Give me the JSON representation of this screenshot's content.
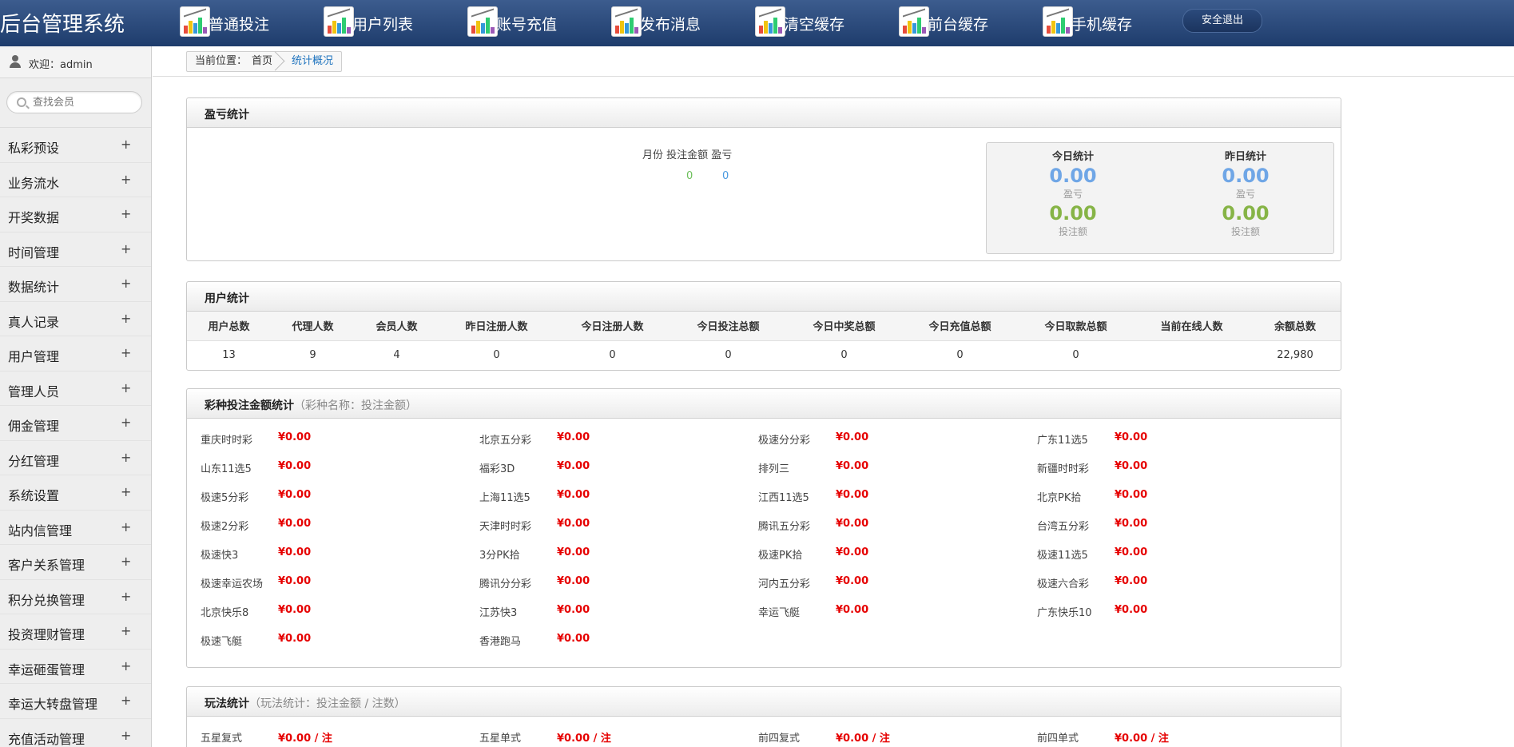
{
  "header": {
    "logo": "后台管理系统",
    "nav": [
      {
        "label": "普通投注",
        "icon": "chart-icon"
      },
      {
        "label": "用户列表",
        "icon": "chart-icon"
      },
      {
        "label": "账号充值",
        "icon": "chart-icon"
      },
      {
        "label": "发布消息",
        "icon": "chart-icon"
      },
      {
        "label": "清空缓存",
        "icon": "chart-icon"
      },
      {
        "label": "前台缓存",
        "icon": "chart-icon"
      },
      {
        "label": "手机缓存",
        "icon": "chart-icon"
      }
    ],
    "logout": "安全退出"
  },
  "sidebar": {
    "welcome": "欢迎：admin",
    "search_placeholder": "查找会员",
    "items": [
      {
        "label": "私彩预设",
        "plus": "+"
      },
      {
        "label": "业务流水",
        "plus": "+"
      },
      {
        "label": "开奖数据",
        "plus": "+"
      },
      {
        "label": "时间管理",
        "plus": "+"
      },
      {
        "label": "数据统计",
        "plus": "+"
      },
      {
        "label": "真人记录",
        "plus": "+"
      },
      {
        "label": "用户管理",
        "plus": "+"
      },
      {
        "label": "管理人员",
        "plus": "+"
      },
      {
        "label": "佣金管理",
        "plus": "+"
      },
      {
        "label": "分红管理",
        "plus": "+"
      },
      {
        "label": "系统设置",
        "plus": "+"
      },
      {
        "label": "站内信管理",
        "plus": "+"
      },
      {
        "label": "客户关系管理",
        "plus": "+"
      },
      {
        "label": "积分兑换管理",
        "plus": "+"
      },
      {
        "label": "投资理财管理",
        "plus": "+"
      },
      {
        "label": "幸运砸蛋管理",
        "plus": "+"
      },
      {
        "label": "幸运大转盘管理",
        "plus": "+"
      },
      {
        "label": "充值活动管理",
        "plus": "+"
      }
    ]
  },
  "breadcrumb": {
    "prefix": "当前位置：",
    "home": "首页",
    "current": "统计概况"
  },
  "profit_panel": {
    "title": "盈亏统计",
    "legend": "月份 投注金额 盈亏",
    "bet_value": "0",
    "profit_value": "0",
    "today": {
      "title": "今日统计",
      "profit": "0.00",
      "profit_label": "盈亏",
      "bet": "0.00",
      "bet_label": "投注额"
    },
    "yesterday": {
      "title": "昨日统计",
      "profit": "0.00",
      "profit_label": "盈亏",
      "bet": "0.00",
      "bet_label": "投注额"
    }
  },
  "user_panel": {
    "title": "用户统计",
    "headers": [
      "用户总数",
      "代理人数",
      "会员人数",
      "昨日注册人数",
      "今日注册人数",
      "今日投注总额",
      "今日中奖总额",
      "今日充值总额",
      "今日取款总额",
      "当前在线人数",
      "余额总数"
    ],
    "values": [
      "13",
      "9",
      "4",
      "0",
      "0",
      "0",
      "0",
      "0",
      "0",
      "",
      "22,980"
    ]
  },
  "lottery_panel": {
    "title": "彩种投注金额统计",
    "subtitle": "（彩种名称：投注金额）",
    "items": [
      {
        "name": "重庆时时彩",
        "value": "¥0.00"
      },
      {
        "name": "北京五分彩",
        "value": "¥0.00"
      },
      {
        "name": "极速分分彩",
        "value": "¥0.00"
      },
      {
        "name": "广东11选5",
        "value": "¥0.00"
      },
      {
        "name": "山东11选5",
        "value": "¥0.00"
      },
      {
        "name": "福彩3D",
        "value": "¥0.00"
      },
      {
        "name": "排列三",
        "value": "¥0.00"
      },
      {
        "name": "新疆时时彩",
        "value": "¥0.00"
      },
      {
        "name": "极速5分彩",
        "value": "¥0.00"
      },
      {
        "name": "上海11选5",
        "value": "¥0.00"
      },
      {
        "name": "江西11选5",
        "value": "¥0.00"
      },
      {
        "name": "北京PK拾",
        "value": "¥0.00"
      },
      {
        "name": "极速2分彩",
        "value": "¥0.00"
      },
      {
        "name": "天津时时彩",
        "value": "¥0.00"
      },
      {
        "name": "腾讯五分彩",
        "value": "¥0.00"
      },
      {
        "name": "台湾五分彩",
        "value": "¥0.00"
      },
      {
        "name": "极速快3",
        "value": "¥0.00"
      },
      {
        "name": "3分PK拾",
        "value": "¥0.00"
      },
      {
        "name": "极速PK拾",
        "value": "¥0.00"
      },
      {
        "name": "极速11选5",
        "value": "¥0.00"
      },
      {
        "name": "极速幸运农场",
        "value": "¥0.00"
      },
      {
        "name": "腾讯分分彩",
        "value": "¥0.00"
      },
      {
        "name": "河内五分彩",
        "value": "¥0.00"
      },
      {
        "name": "极速六合彩",
        "value": "¥0.00"
      },
      {
        "name": "北京快乐8",
        "value": "¥0.00"
      },
      {
        "name": "江苏快3",
        "value": "¥0.00"
      },
      {
        "name": "幸运飞艇",
        "value": "¥0.00"
      },
      {
        "name": "广东快乐10",
        "value": "¥0.00"
      },
      {
        "name": "极速飞艇",
        "value": "¥0.00"
      },
      {
        "name": "香港跑马",
        "value": "¥0.00"
      }
    ]
  },
  "play_panel": {
    "title": "玩法统计",
    "subtitle": "（玩法统计：投注金额 / 注数）",
    "items": [
      {
        "name": "五星复式",
        "value": "¥0.00 / 注"
      },
      {
        "name": "五星单式",
        "value": "¥0.00 / 注"
      },
      {
        "name": "前四复式",
        "value": "¥0.00 / 注"
      },
      {
        "name": "前四单式",
        "value": "¥0.00 / 注"
      }
    ]
  }
}
